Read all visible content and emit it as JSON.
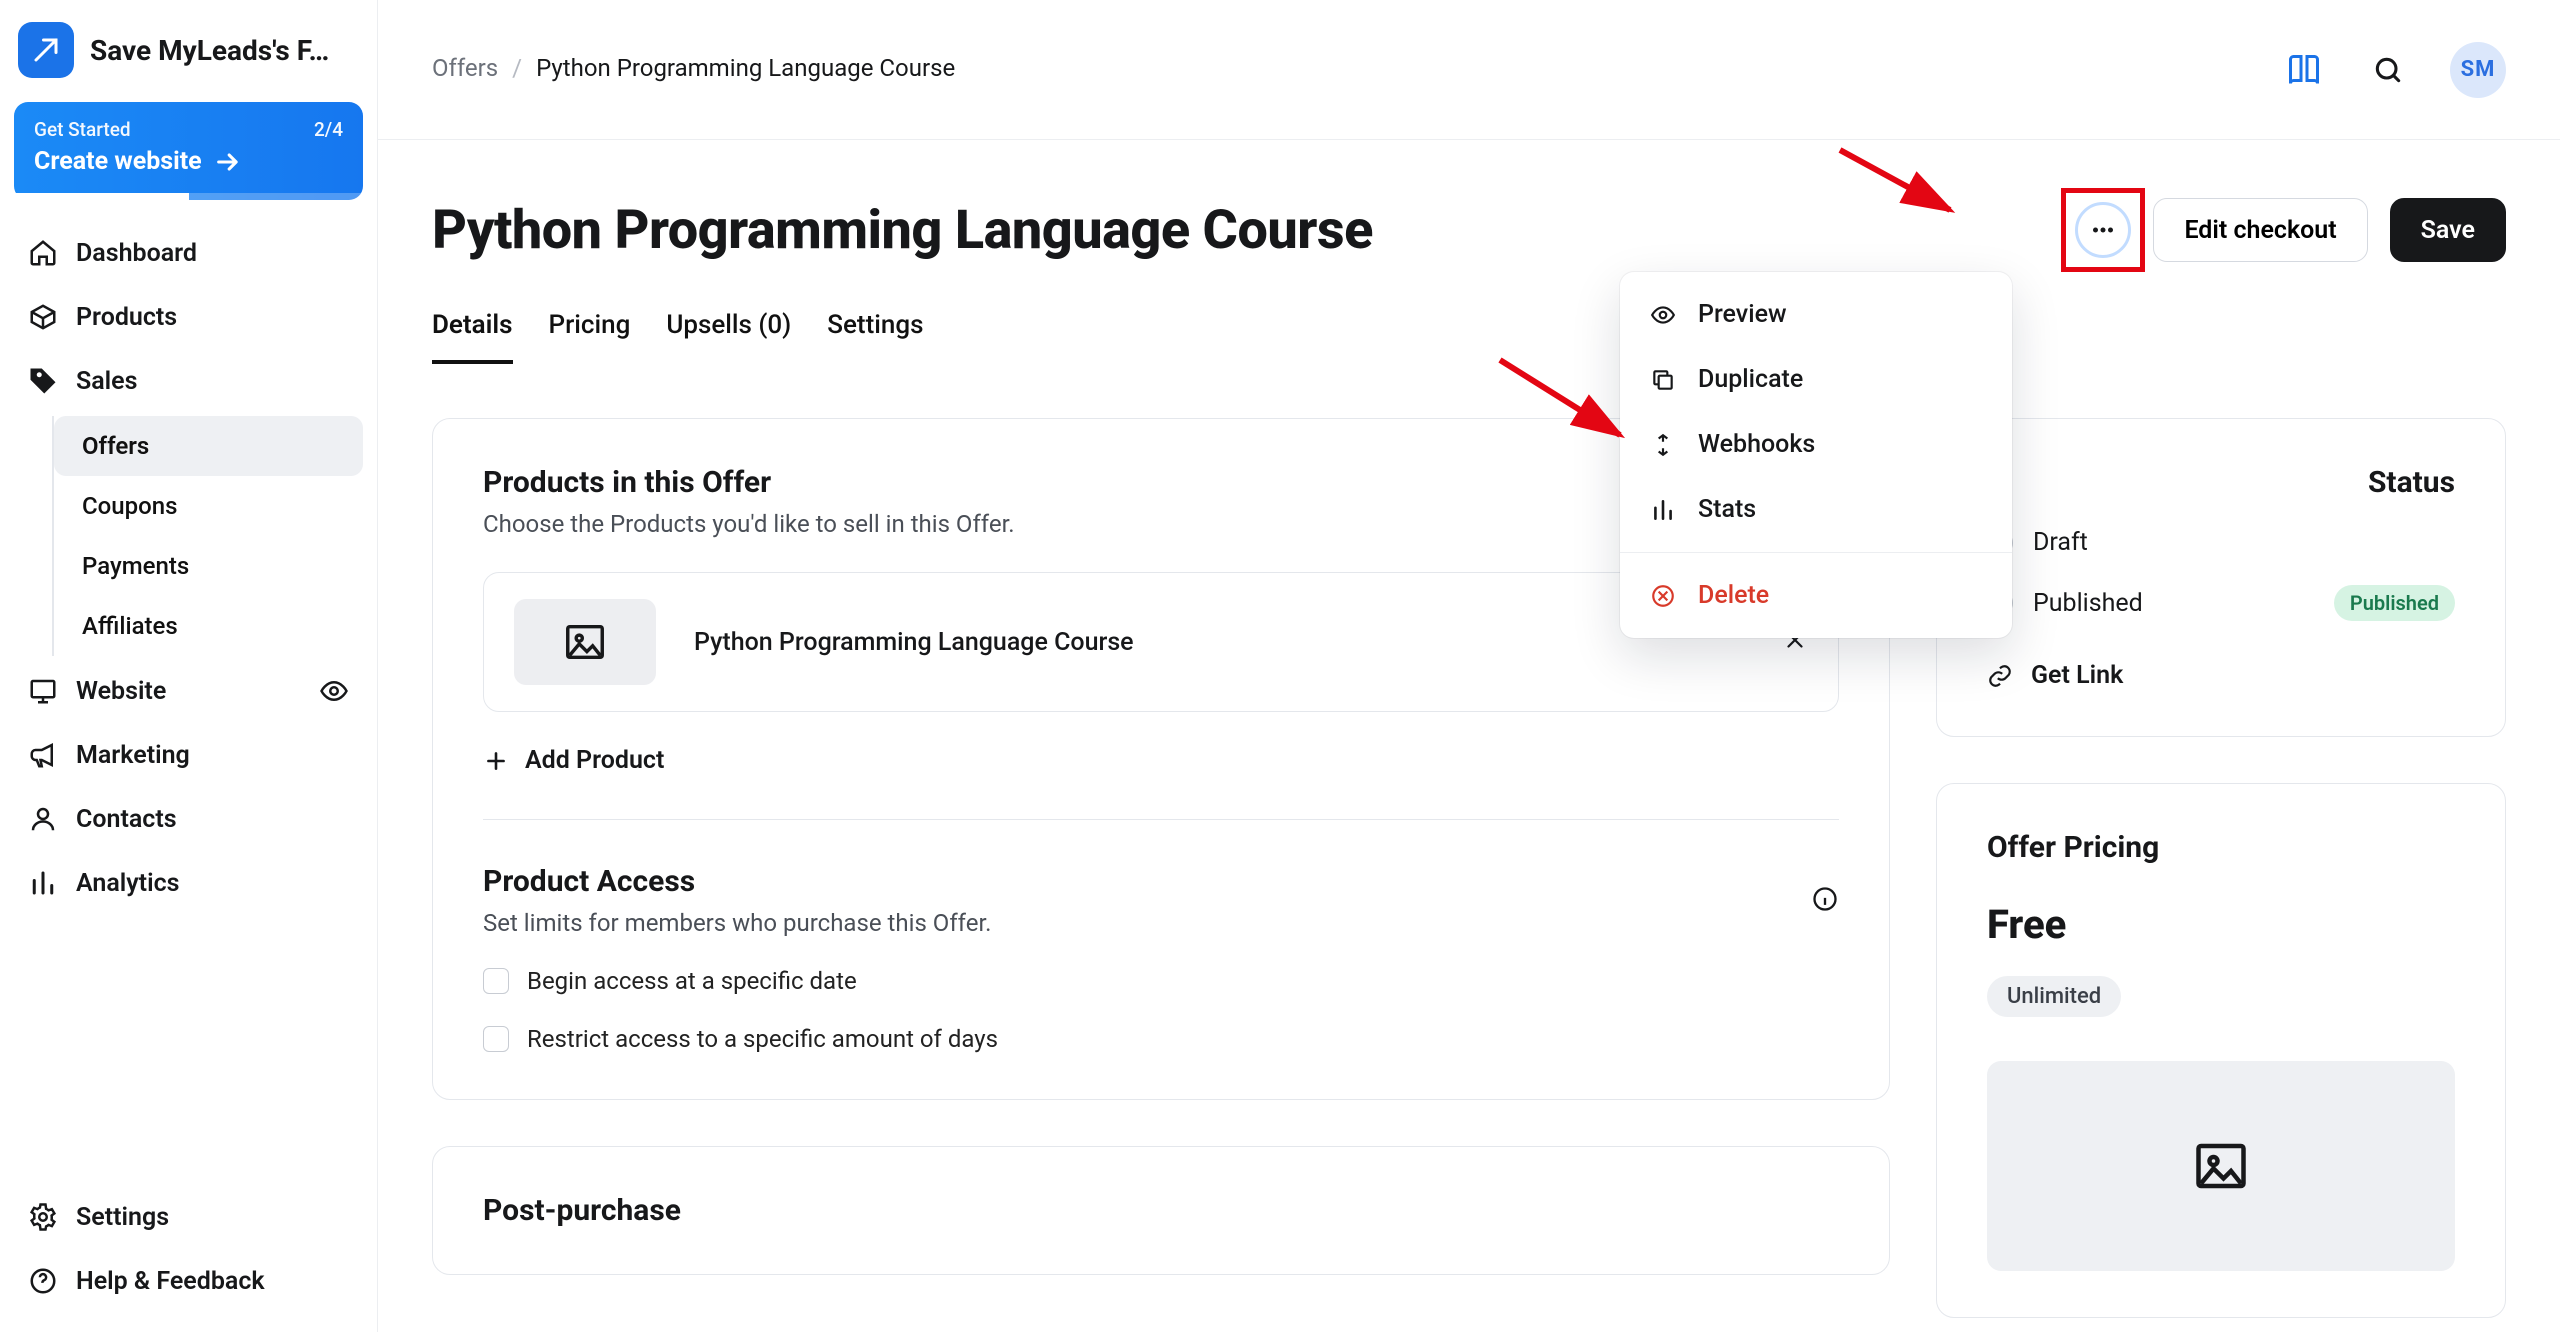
{
  "brand": {
    "title": "Save MyLeads's F…"
  },
  "cta": {
    "top_label": "Get Started",
    "progress_text": "2/4",
    "main_label": "Create website"
  },
  "nav": {
    "items": [
      {
        "key": "dashboard",
        "label": "Dashboard"
      },
      {
        "key": "products",
        "label": "Products"
      },
      {
        "key": "sales",
        "label": "Sales"
      },
      {
        "key": "website",
        "label": "Website"
      },
      {
        "key": "marketing",
        "label": "Marketing"
      },
      {
        "key": "contacts",
        "label": "Contacts"
      },
      {
        "key": "analytics",
        "label": "Analytics"
      }
    ],
    "sales_sub": [
      {
        "key": "offers",
        "label": "Offers",
        "active": true
      },
      {
        "key": "coupons",
        "label": "Coupons"
      },
      {
        "key": "payments",
        "label": "Payments"
      },
      {
        "key": "affiliates",
        "label": "Affiliates"
      }
    ],
    "bottom": [
      {
        "key": "settings",
        "label": "Settings"
      },
      {
        "key": "help",
        "label": "Help & Feedback"
      }
    ]
  },
  "breadcrumb": {
    "root": "Offers",
    "current": "Python Programming Language Course"
  },
  "header": {
    "avatar_initials": "SM"
  },
  "page": {
    "title": "Python Programming Language Course",
    "actions": {
      "edit_checkout": "Edit checkout",
      "save": "Save"
    },
    "tabs": [
      {
        "key": "details",
        "label": "Details",
        "active": true
      },
      {
        "key": "pricing",
        "label": "Pricing"
      },
      {
        "key": "upsells",
        "label": "Upsells (0)"
      },
      {
        "key": "settings",
        "label": "Settings"
      }
    ]
  },
  "products_section": {
    "title": "Products in this Offer",
    "subtitle": "Choose the Products you'd like to sell in this Offer.",
    "items": [
      {
        "name": "Python Programming Language Course"
      }
    ],
    "add_label": "Add Product"
  },
  "access_section": {
    "title": "Product Access",
    "subtitle": "Set limits for members who purchase this Offer.",
    "checkboxes": [
      {
        "key": "begin_date",
        "label": "Begin access at a specific date"
      },
      {
        "key": "restrict_days",
        "label": "Restrict access to a specific amount of days"
      }
    ]
  },
  "post_section": {
    "title": "Post-purchase"
  },
  "status_panel": {
    "title": "Status",
    "options": [
      {
        "key": "draft",
        "label": "Draft",
        "checked": false
      },
      {
        "key": "published",
        "label": "Published",
        "checked": true
      }
    ],
    "badge": "Published",
    "get_link": "Get Link"
  },
  "pricing_panel": {
    "title": "Offer Pricing",
    "amount": "Free",
    "chip": "Unlimited"
  },
  "menu": {
    "items": [
      {
        "key": "preview",
        "label": "Preview"
      },
      {
        "key": "duplicate",
        "label": "Duplicate"
      },
      {
        "key": "webhooks",
        "label": "Webhooks"
      },
      {
        "key": "stats",
        "label": "Stats"
      }
    ],
    "danger": {
      "key": "delete",
      "label": "Delete"
    }
  }
}
